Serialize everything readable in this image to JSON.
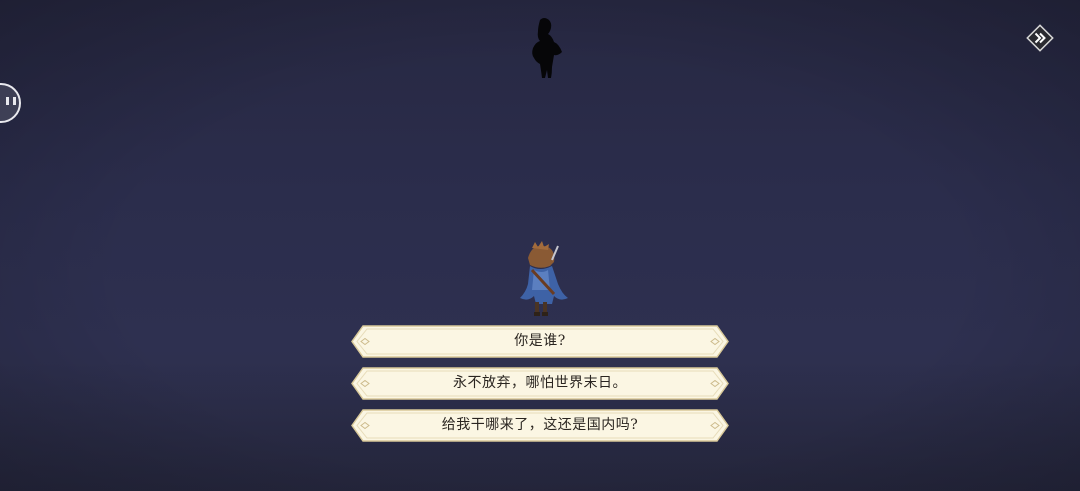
{
  "scene": {
    "silhouette_icon": "shadow-figure-icon",
    "hero_icon": "hero-character-icon"
  },
  "controls": {
    "skip_icon": "fast-forward-icon",
    "side_icon": "chat-bubble-icon"
  },
  "dialogue": {
    "choices": [
      {
        "label": "你是谁?"
      },
      {
        "label": "永不放弃，哪怕世界末日。"
      },
      {
        "label": "给我干哪来了，这还是国内吗?"
      }
    ]
  },
  "colors": {
    "choice_fill": "#fbf6e3",
    "choice_border": "#d9c99a",
    "text": "#2a2520"
  }
}
